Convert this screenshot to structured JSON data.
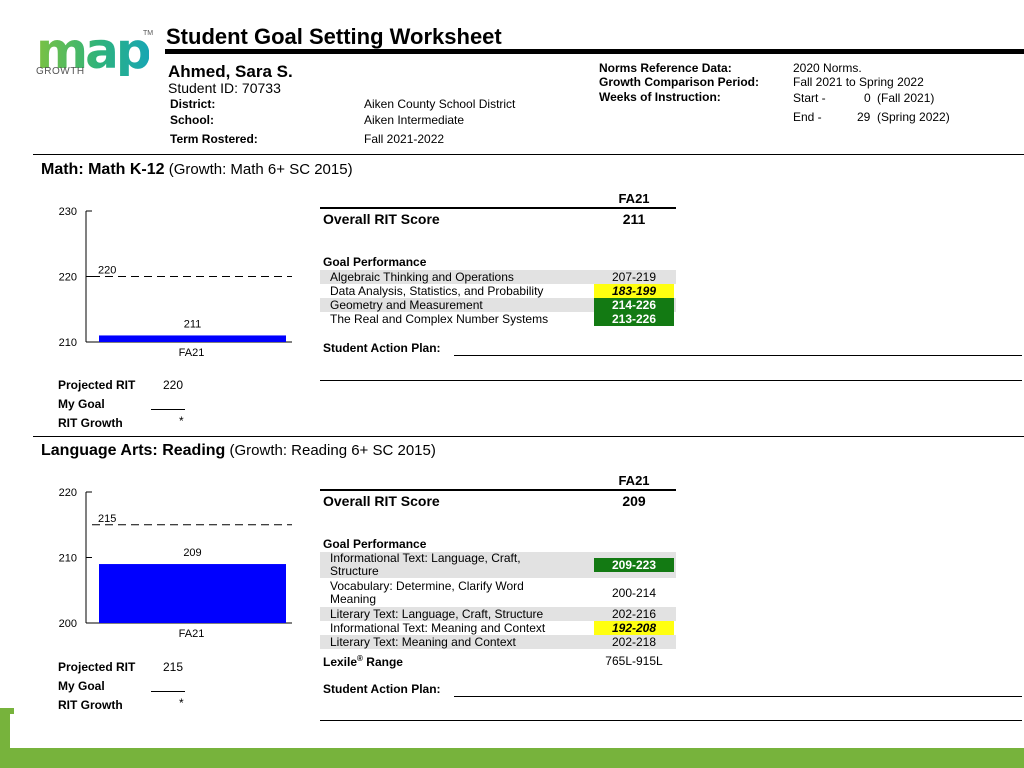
{
  "logo": {
    "wordmark": "map",
    "tm": "TM",
    "sub": "GROWTH"
  },
  "header": {
    "title": "Student Goal Setting Worksheet",
    "student_name": "Ahmed, Sara S.",
    "student_id": "Student ID: 70733",
    "district_label": "District:",
    "district": "Aiken County School District",
    "school_label": "School:",
    "school": "Aiken Intermediate",
    "term_label": "Term Rostered:",
    "term": "Fall 2021-2022",
    "norms_label": "Norms Reference Data:",
    "norms": "2020 Norms.",
    "period_label": "Growth Comparison Period:",
    "period": "Fall 2021 to Spring 2022",
    "weeks_label": "Weeks of Instruction:",
    "start_label": "Start -",
    "start_value": "0",
    "start_term": "(Fall 2021)",
    "end_label": "End -",
    "end_value": "29",
    "end_term": "(Spring 2022)"
  },
  "math": {
    "title": "Math: Math K-12",
    "growth": "(Growth: Math 6+ SC 2015)",
    "term_header": "FA21",
    "overall_label": "Overall RIT Score",
    "overall": "211",
    "goal_header": "Goal Performance",
    "goals": [
      {
        "name": "Algebraic Thinking and Operations",
        "range": "207-219",
        "status": "plain"
      },
      {
        "name": "Data Analysis, Statistics, and Probability",
        "range": "183-199",
        "status": "yellow"
      },
      {
        "name": "Geometry and Measurement",
        "range": "214-226",
        "status": "green"
      },
      {
        "name": "The Real and Complex Number Systems",
        "range": "213-226",
        "status": "green"
      }
    ],
    "action_plan": "Student Action Plan:",
    "projected_label": "Projected RIT",
    "projected": "220",
    "goal_label": "My Goal",
    "growth_label": "RIT Growth",
    "growth_value": "*",
    "chart_data": {
      "type": "bar",
      "categories": [
        "FA21"
      ],
      "values": [
        211
      ],
      "ylim": [
        210,
        230
      ],
      "yticks": [
        "230",
        "220",
        "210"
      ],
      "projected_line": 220,
      "projected_label": "220",
      "bar_label": "211",
      "bar_color": "#0000ff"
    }
  },
  "reading": {
    "title": "Language Arts: Reading",
    "growth": "(Growth: Reading 6+ SC 2015)",
    "term_header": "FA21",
    "overall_label": "Overall RIT Score",
    "overall": "209",
    "goal_header": "Goal Performance",
    "goals": [
      {
        "name1": "Informational Text: Language, Craft,",
        "name2": "Structure",
        "range": "209-223",
        "status": "green"
      },
      {
        "name1": "Vocabulary: Determine, Clarify Word",
        "name2": "Meaning",
        "range": "200-214",
        "status": "plain"
      },
      {
        "name": "Literary Text: Language, Craft, Structure",
        "range": "202-216",
        "status": "plain"
      },
      {
        "name": "Informational Text: Meaning and Context",
        "range": "192-208",
        "status": "yellow"
      },
      {
        "name": "Literary Text: Meaning and Context",
        "range": "202-218",
        "status": "plain"
      }
    ],
    "lexile_label": "Lexile",
    "lexile_reg": "®",
    "lexile_label2": " Range",
    "lexile": "765L-915L",
    "action_plan": "Student Action Plan:",
    "projected_label": "Projected RIT",
    "projected": "215",
    "goal_label": "My Goal",
    "growth_label": "RIT Growth",
    "growth_value": "*",
    "chart_data": {
      "type": "bar",
      "categories": [
        "FA21"
      ],
      "values": [
        209
      ],
      "ylim": [
        200,
        220
      ],
      "yticks": [
        "220",
        "210",
        "200"
      ],
      "projected_line": 215,
      "projected_label": "215",
      "bar_label": "209",
      "bar_color": "#0000ff"
    }
  }
}
